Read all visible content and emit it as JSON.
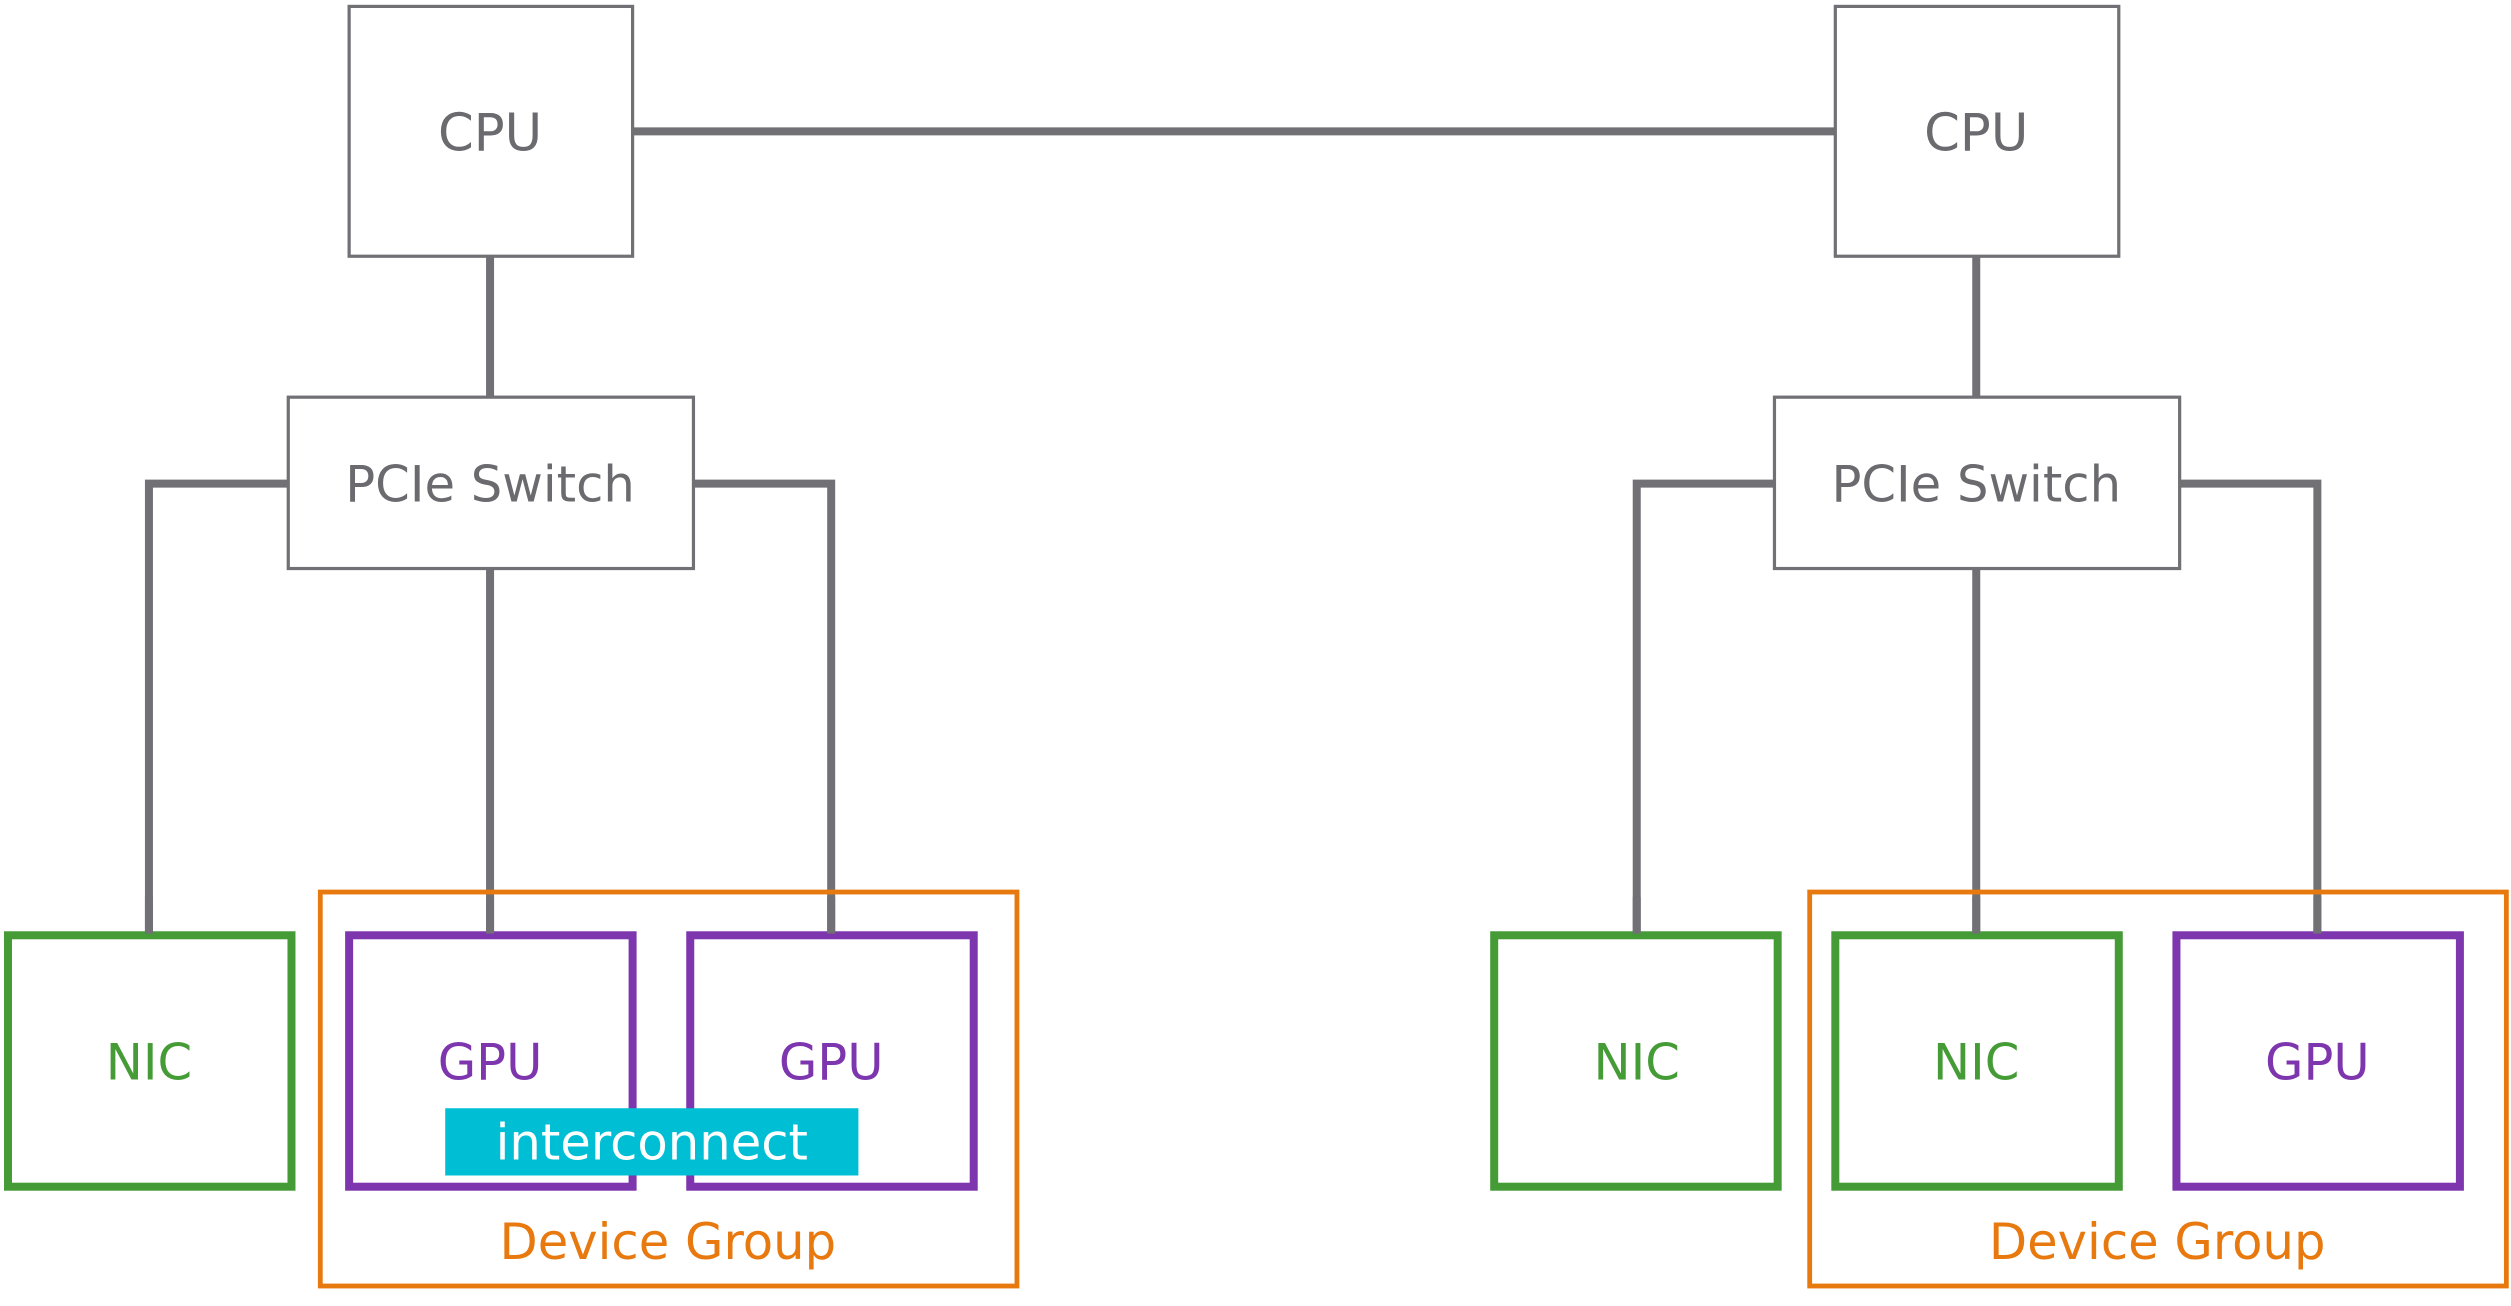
{
  "colors": {
    "connector": "#717074",
    "box_border": "#717074",
    "text_gray": "#6b6b6f",
    "nic": "#459c37",
    "gpu": "#7d36ad",
    "device_group": "#e8790f",
    "interconnect": "#00bfd4",
    "interconnect_text": "#ffffff"
  },
  "left": {
    "cpu": "CPU",
    "switch": "PCIe Switch",
    "devices": [
      "NIC",
      "GPU",
      "GPU"
    ],
    "interconnect": "interconnect",
    "group_label": "Device Group"
  },
  "right": {
    "cpu": "CPU",
    "switch": "PCIe Switch",
    "devices": [
      "NIC",
      "NIC",
      "GPU"
    ],
    "group_label": "Device Group"
  }
}
